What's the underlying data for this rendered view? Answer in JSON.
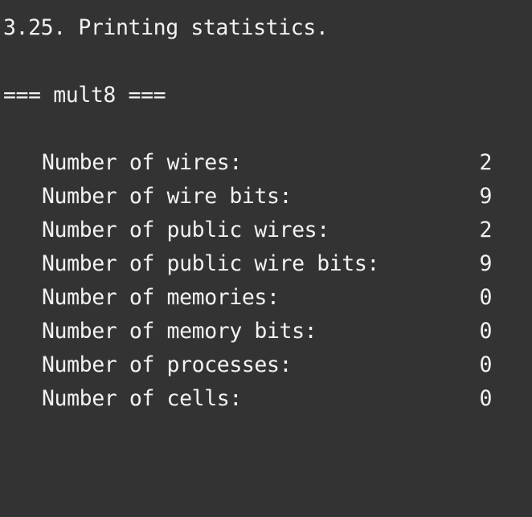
{
  "terminal": {
    "background": "#333333",
    "foreground": "#f2f2f2",
    "heading": "3.25. Printing statistics.",
    "module_header": "=== mult8 ===",
    "stats": [
      {
        "label": "Number of wires:",
        "value": "2"
      },
      {
        "label": "Number of wire bits:",
        "value": "9"
      },
      {
        "label": "Number of public wires:",
        "value": "2"
      },
      {
        "label": "Number of public wire bits:",
        "value": "9"
      },
      {
        "label": "Number of memories:",
        "value": "0"
      },
      {
        "label": "Number of memory bits:",
        "value": "0"
      },
      {
        "label": "Number of processes:",
        "value": "0"
      },
      {
        "label": "Number of cells:",
        "value": "0"
      }
    ]
  }
}
